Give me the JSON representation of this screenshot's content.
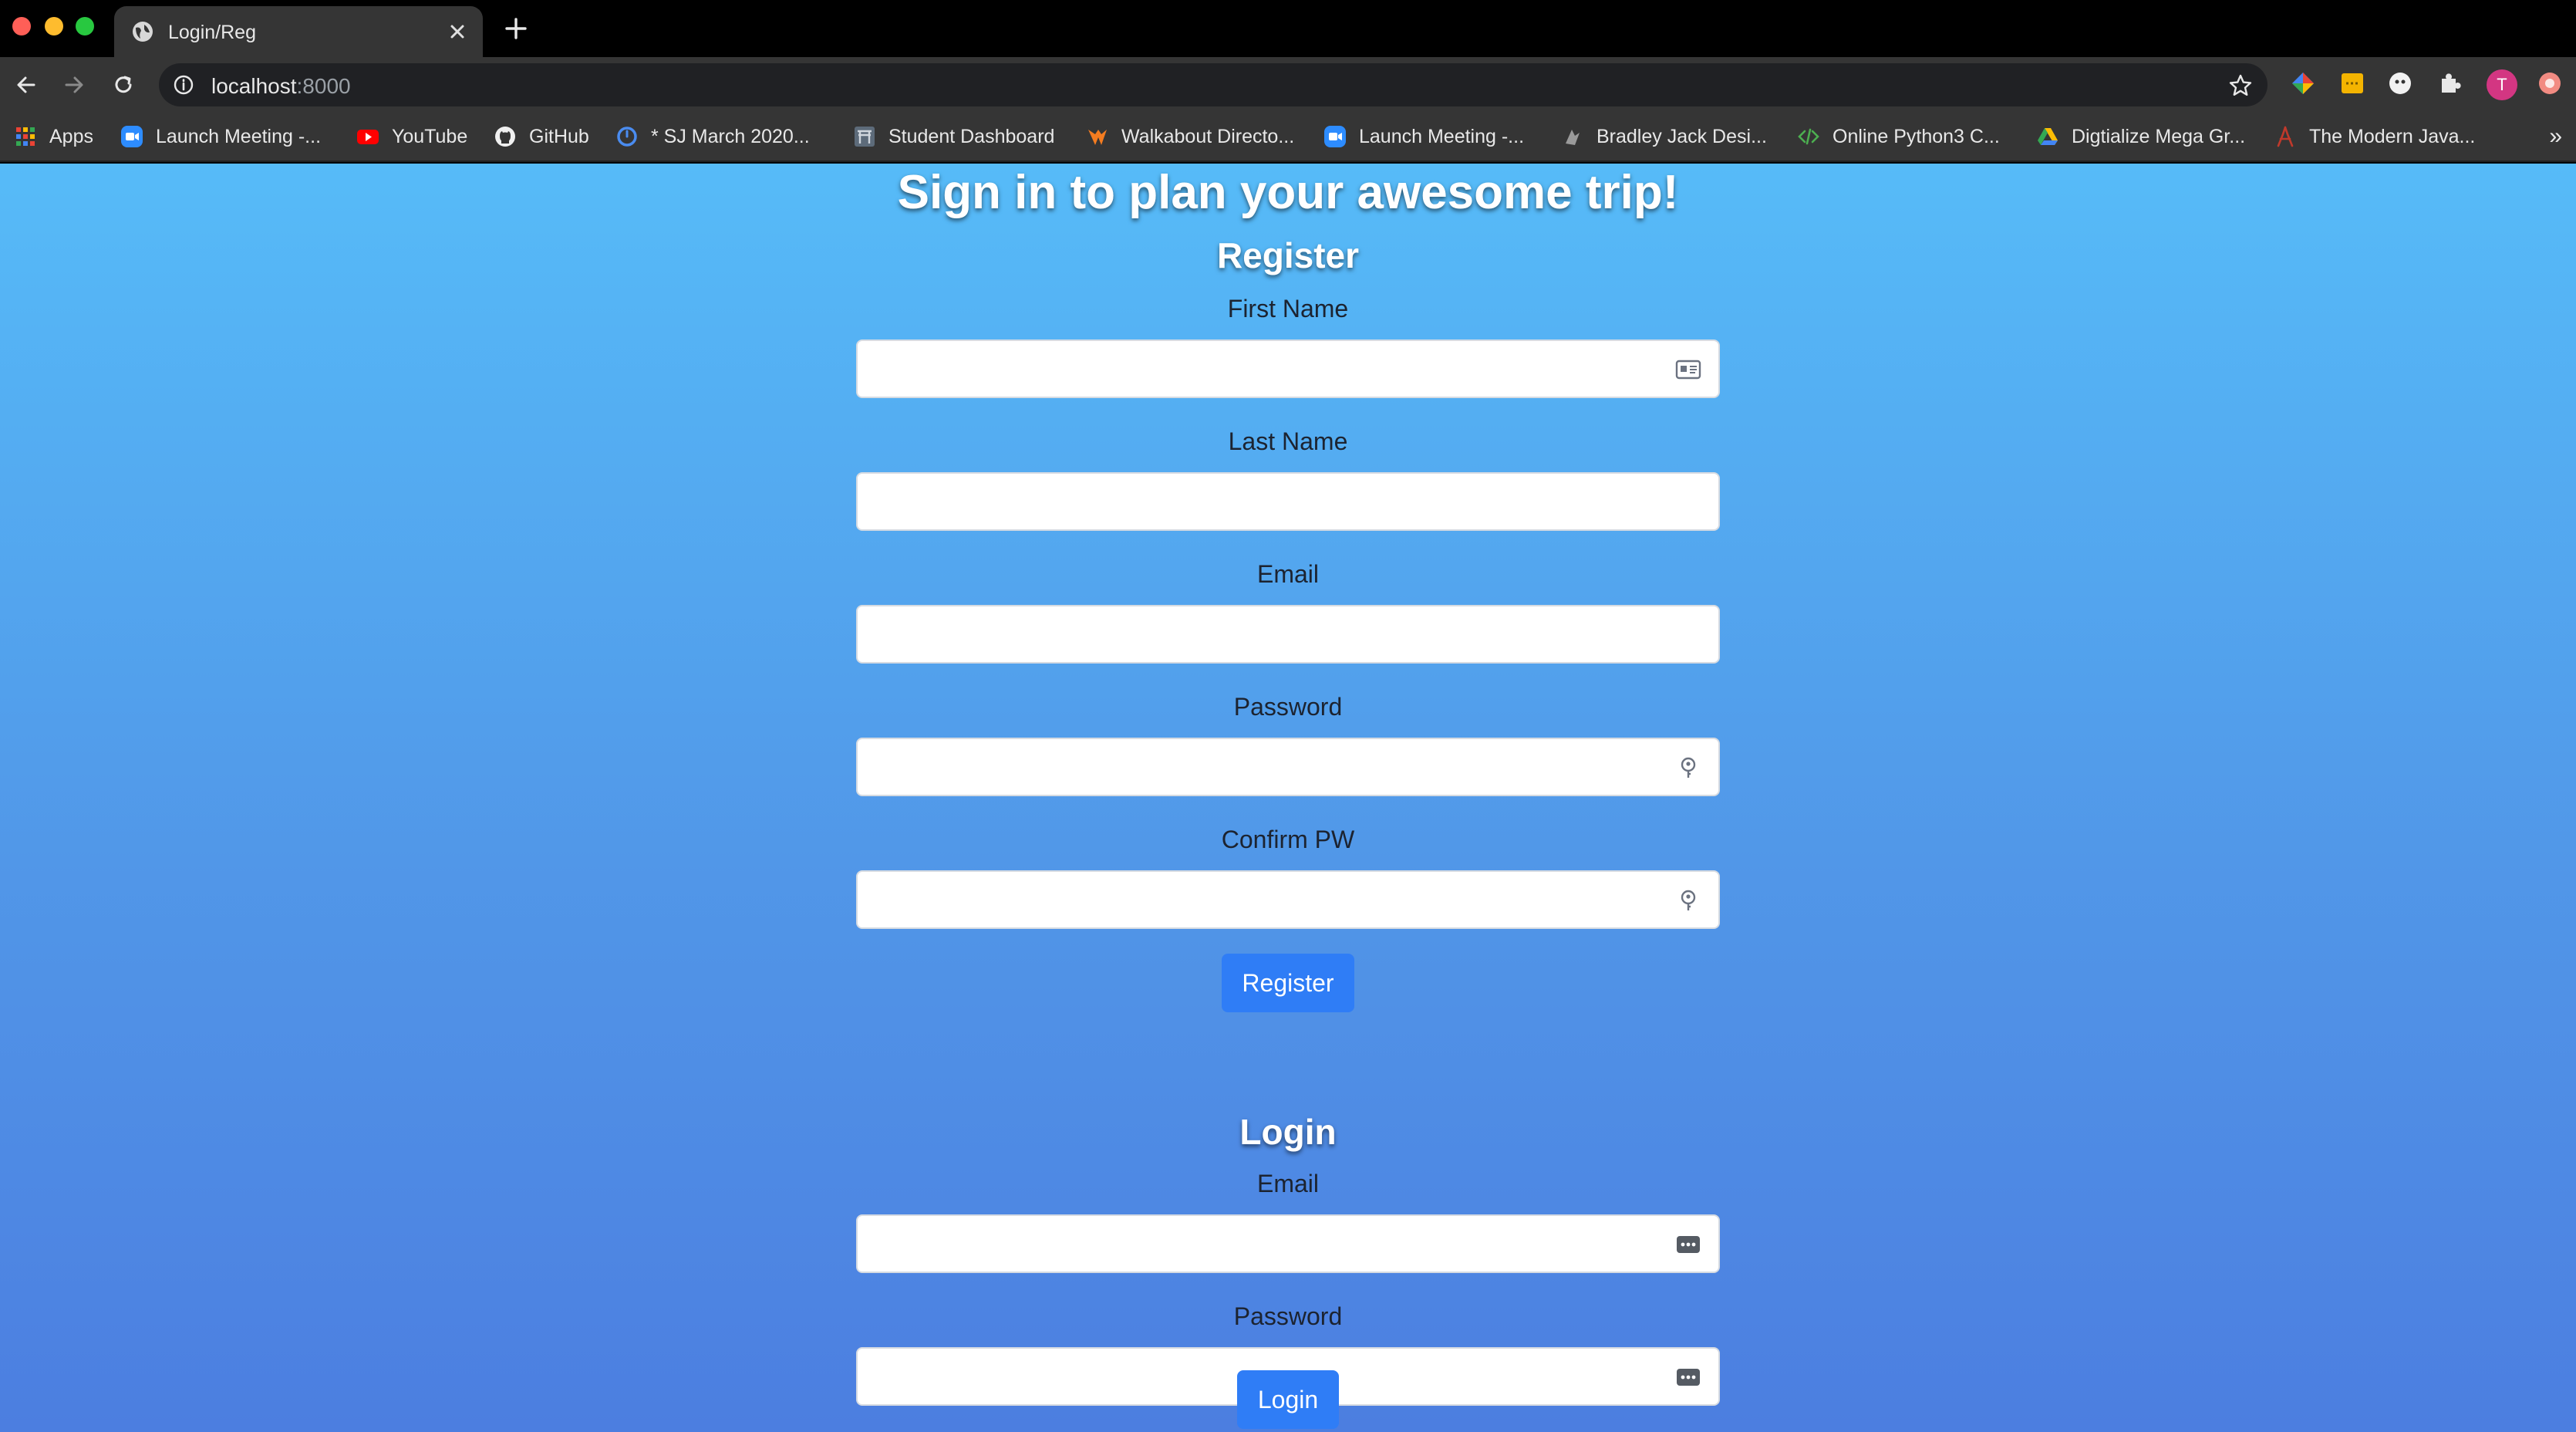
{
  "browser": {
    "tab_title": "Login/Reg",
    "url_host": "localhost",
    "url_port": ":8000",
    "avatar_letter": "T",
    "bookmarks": [
      "Apps",
      "Launch Meeting -...",
      "YouTube",
      "GitHub",
      "* SJ March 2020...",
      "Student Dashboard",
      "Walkabout Directo...",
      "Launch Meeting -...",
      "Bradley Jack Desi...",
      "Online Python3 C...",
      "Digtialize Mega Gr...",
      "The Modern Java..."
    ],
    "more_bookmarks": "»"
  },
  "page": {
    "headline": "Sign in to plan your awesome trip!",
    "register": {
      "title": "Register",
      "first_name_label": "First Name",
      "last_name_label": "Last Name",
      "email_label": "Email",
      "password_label": "Password",
      "confirm_label": "Confirm PW",
      "submit": "Register"
    },
    "login": {
      "title": "Login",
      "email_label": "Email",
      "password_label": "Password",
      "submit": "Login"
    }
  },
  "colors": {
    "gradient_top": "#56bbf8",
    "gradient_bottom": "#4c7ee0",
    "button": "#2f7df6"
  }
}
